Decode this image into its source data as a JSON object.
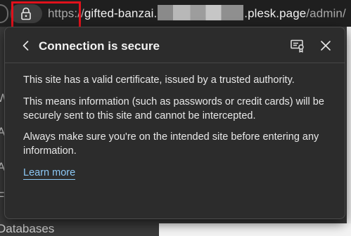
{
  "browser": {
    "url": {
      "scheme": "https://",
      "host_prefix": "gifted-banzai.",
      "host_suffix": ".plesk.page",
      "path": "/admin/"
    }
  },
  "background": {
    "sidebar_visible_text": "Databases"
  },
  "popup": {
    "title": "Connection is secure",
    "paragraphs": [
      "This site has a valid certificate, issued by a trusted authority.",
      "This means information (such as passwords or credit cards) will be securely sent to this site and cannot be intercepted.",
      "Always make sure you're on the intended site before entering any information."
    ],
    "learn_more_label": "Learn more",
    "icons": {
      "back": "chevron-left-icon",
      "certificate": "certificate-icon",
      "close": "close-icon"
    }
  },
  "colors": {
    "highlight": "#e0111b",
    "link": "#8cc8f5",
    "popup_bg": "#2c2c2c"
  }
}
